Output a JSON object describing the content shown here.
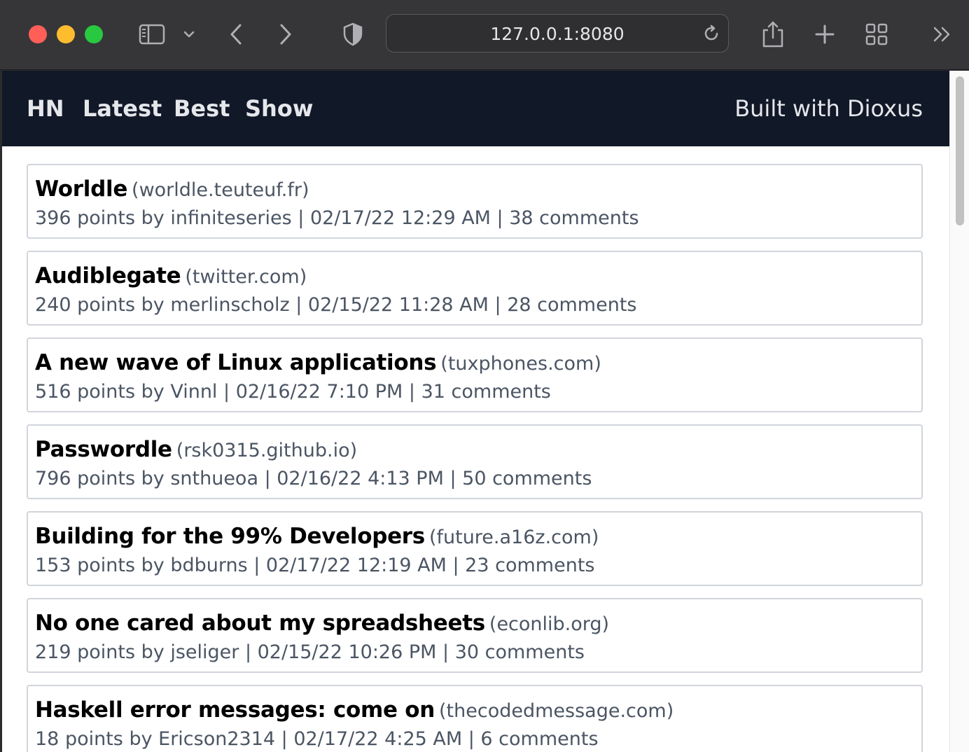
{
  "browser": {
    "url": "127.0.0.1:8080",
    "icons": [
      "sidebar-icon",
      "chevron-down-icon",
      "back-icon",
      "forward-icon",
      "shield-icon",
      "reload-icon",
      "share-icon",
      "plus-icon",
      "tabs-overview-icon",
      "more-icon"
    ]
  },
  "nav": {
    "links": [
      {
        "label": "HN"
      },
      {
        "label": "Latest"
      },
      {
        "label": "Best"
      },
      {
        "label": "Show"
      }
    ],
    "right_label": "Built with Dioxus",
    "background": "#111827"
  },
  "stories": [
    {
      "title": "Worldle",
      "domain": "(worldle.teuteuf.fr)",
      "meta": "396 points by infiniteseries | 02/17/22 12:29 AM | 38 comments"
    },
    {
      "title": "Audiblegate",
      "domain": "(twitter.com)",
      "meta": "240 points by merlinscholz | 02/15/22 11:28 AM | 28 comments"
    },
    {
      "title": "A new wave of Linux applications",
      "domain": "(tuxphones.com)",
      "meta": "516 points by Vinnl | 02/16/22 7:10 PM | 31 comments"
    },
    {
      "title": "Passwordle",
      "domain": "(rsk0315.github.io)",
      "meta": "796 points by snthueoa | 02/16/22 4:13 PM | 50 comments"
    },
    {
      "title": "Building for the 99% Developers",
      "domain": "(future.a16z.com)",
      "meta": "153 points by bdburns | 02/17/22 12:19 AM | 23 comments"
    },
    {
      "title": "No one cared about my spreadsheets",
      "domain": "(econlib.org)",
      "meta": "219 points by jseliger | 02/15/22 10:26 PM | 30 comments"
    },
    {
      "title": "Haskell error messages: come on",
      "domain": "(thecodedmessage.com)",
      "meta": "18 points by Ericson2314 | 02/17/22 4:25 AM | 6 comments"
    }
  ]
}
